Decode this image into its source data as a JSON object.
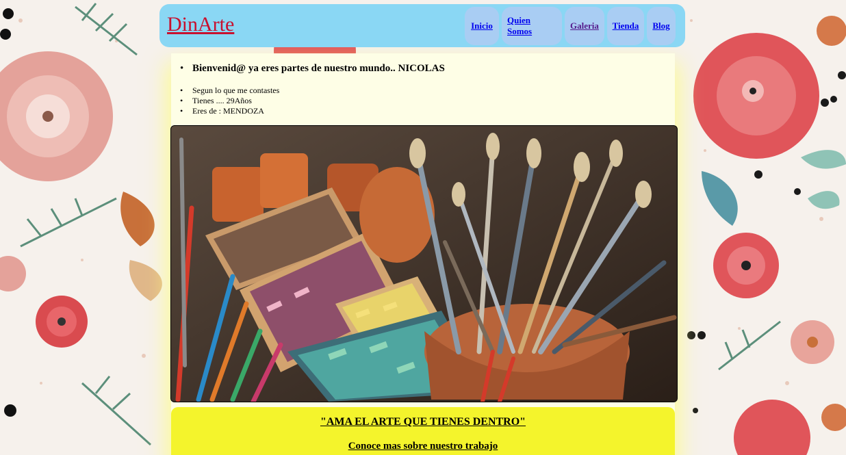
{
  "header": {
    "logo": "DinArte",
    "nav": [
      {
        "label": "Inicio",
        "visited": false
      },
      {
        "label": "Quien Somos",
        "visited": false
      },
      {
        "label": "Galeria",
        "visited": true
      },
      {
        "label": "Tienda",
        "visited": false
      },
      {
        "label": "Blog",
        "visited": false
      }
    ]
  },
  "welcome": {
    "message": "Bienvenid@ ya eres partes de nuestro mundo.. NICOLAS",
    "details": [
      "Segun lo que me contastes",
      "Tienes .... 29Años",
      "Eres de : MENDOZA"
    ]
  },
  "hero": {
    "image": "art-supplies-photo"
  },
  "banner": {
    "quote": "\"AMA EL ARTE QUE TIENES DENTRO\"",
    "link": "Conoce mas sobre nuestro trabajo"
  },
  "colors": {
    "header_bg": "#8ad7f4",
    "nav_bg": "#a9cdf3",
    "logo": "#c8102e",
    "content_bg": "#fefee6",
    "banner_bg": "#f4f42c"
  }
}
